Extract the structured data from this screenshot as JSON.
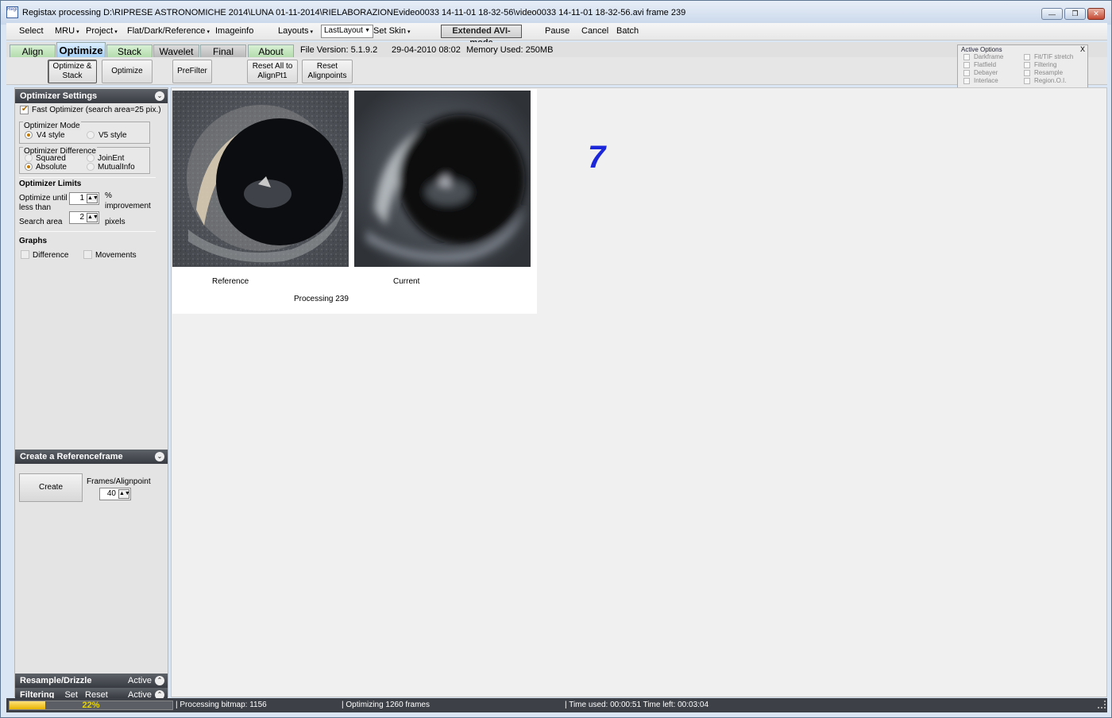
{
  "window": {
    "title": "Registax processing D:\\RIPRESE ASTRONOMICHE 2014\\LUNA 01-11-2014\\RIELABORAZIONEvideo0033 14-11-01 18-32-56\\video0033 14-11-01 18-32-56.avi frame 239",
    "icon_text": "RegiStax",
    "min_glyph": "—",
    "max_glyph": "❐",
    "close_glyph": "✕"
  },
  "menu": {
    "select": "Select",
    "mru": "MRU",
    "project": "Project",
    "flat": "Flat/Dark/Reference",
    "imageinfo": "Imageinfo",
    "layouts": "Layouts",
    "layout_value": "LastLayout",
    "set_skin": "Set Skin",
    "extended_avi": "Extended AVI-mode",
    "pause": "Pause",
    "cancel": "Cancel",
    "batch": "Batch",
    "arrow": "▾"
  },
  "tabs": {
    "align": "Align",
    "optimize": "Optimize",
    "stack": "Stack",
    "wavelet": "Wavelet",
    "final": "Final",
    "about": "About"
  },
  "fileinfo": {
    "version": "File Version: 5.1.9.2",
    "date": "29-04-2010 08:02",
    "memory": "Memory Used: 250MB"
  },
  "toolbar": {
    "optimize_stack": "Optimize &\nStack",
    "optimize": "Optimize",
    "prefilter": "PreFilter",
    "reset_all": "Reset All to\nAlignPt1",
    "reset_alignpoints": "Reset\nAlignpoints"
  },
  "active_options": {
    "title": "Active Options",
    "close": "X",
    "left": [
      "Darkframe",
      "Flatfield",
      "Debayer",
      "Interlace"
    ],
    "right": [
      "Fit/TIF stretch",
      "Filtering",
      "Resample",
      "Region.O.I."
    ]
  },
  "optimizer": {
    "header": "Optimizer Settings",
    "fast_optimizer": "Fast Optimizer (search area=25 pix.)",
    "mode_title": "Optimizer Mode",
    "v4": "V4 style",
    "v5": "V5 style",
    "diff_title": "Optimizer Difference",
    "squared": "Squared",
    "joinent": "JoinEnt",
    "absolute": "Absolute",
    "mutualinfo": "MutualInfo",
    "limits_title": "Optimizer Limits",
    "until_label": "Optimize until\nless than",
    "until_value": "1",
    "percent": "%",
    "improvement": "improvement",
    "search_label": "Search area",
    "search_value": "2",
    "pixels": "pixels",
    "graphs_title": "Graphs",
    "difference": "Difference",
    "movements": "Movements"
  },
  "referenceframe": {
    "header": "Create a Referenceframe",
    "create": "Create",
    "frames_label": "Frames/Alignpoint",
    "frames_value": "40"
  },
  "bottom_sections": {
    "resample": "Resample/Drizzle",
    "resample_status": "Active",
    "filtering": "Filtering",
    "filtering_set": "Set",
    "filtering_reset": "Reset",
    "filtering_status": "Active"
  },
  "main": {
    "reference_label": "Reference",
    "current_label": "Current",
    "processing": "Processing 239",
    "counter": "7"
  },
  "status": {
    "progress_percent": 22,
    "progress_text": "22%",
    "bitmap": "Processing bitmap: 1156",
    "optimizing": "Optimizing 1260 frames",
    "time": "Time used: 00:00:51 Time left: 00:03:04"
  }
}
